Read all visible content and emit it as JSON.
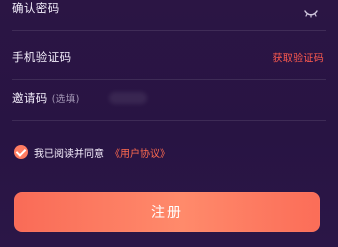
{
  "form": {
    "confirm_password": {
      "label": "确认密码",
      "icon": "eye-off-icon"
    },
    "phone_code": {
      "label": "手机验证码",
      "action": "获取验证码"
    },
    "invite_code": {
      "label": "邀请码",
      "hint": "(选填)"
    },
    "agreement": {
      "text": "我已阅读并同意",
      "link": "《用户协议》",
      "checked": true
    },
    "submit": {
      "label": "注册"
    }
  },
  "colors": {
    "background": "#2a1745",
    "accent": "#ff6b4f",
    "button_start": "#f96b57",
    "button_end": "#ff8a6b"
  }
}
